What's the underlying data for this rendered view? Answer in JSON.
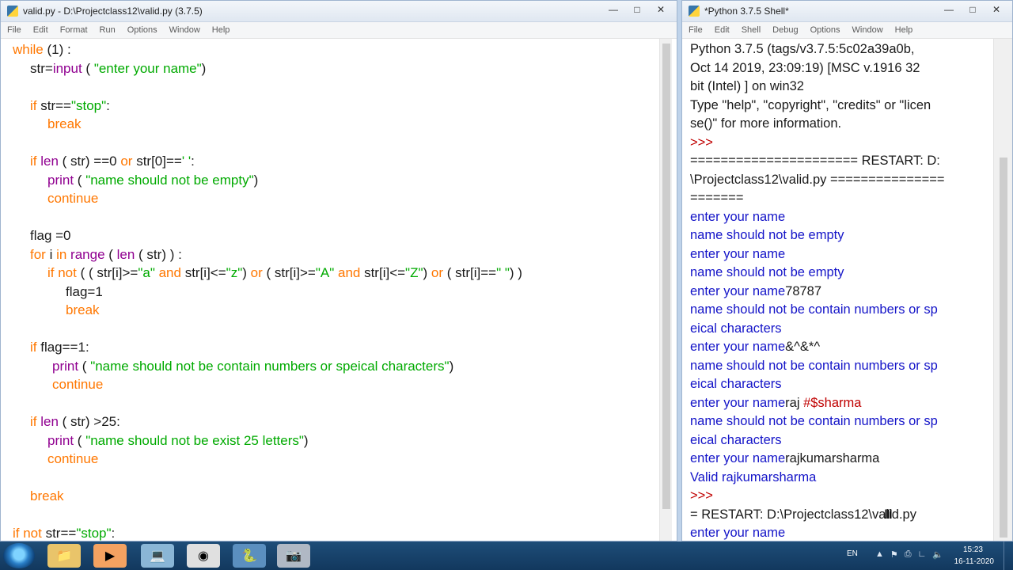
{
  "editor": {
    "title": "valid.py - D:\\Projectclass12\\valid.py (3.7.5)",
    "menu": [
      "File",
      "Edit",
      "Format",
      "Run",
      "Options",
      "Window",
      "Help"
    ],
    "lines": [
      {
        "indent": 15,
        "y": 0,
        "tokens": [
          {
            "t": "while",
            "c": "kw"
          },
          {
            "t": " (1) :",
            "c": "tx"
          }
        ]
      },
      {
        "indent": 37,
        "y": 1,
        "tokens": [
          {
            "t": "str",
            "c": "tx"
          },
          {
            "t": "=",
            "c": "tx"
          },
          {
            "t": "input",
            "c": "bi"
          },
          {
            "t": " ( ",
            "c": "tx"
          },
          {
            "t": "\"enter your name\"",
            "c": "st"
          },
          {
            "t": ")",
            "c": "tx"
          }
        ]
      },
      {
        "indent": 37,
        "y": 3,
        "tokens": [
          {
            "t": "if",
            "c": "kw"
          },
          {
            "t": " str==",
            "c": "tx"
          },
          {
            "t": "\"stop\"",
            "c": "st"
          },
          {
            "t": ":",
            "c": "tx"
          }
        ]
      },
      {
        "indent": 59,
        "y": 4,
        "tokens": [
          {
            "t": "break",
            "c": "kw"
          }
        ]
      },
      {
        "indent": 37,
        "y": 6,
        "tokens": [
          {
            "t": "if",
            "c": "kw"
          },
          {
            "t": " ",
            "c": "tx"
          },
          {
            "t": "len",
            "c": "bi"
          },
          {
            "t": " ( str) ==0 ",
            "c": "tx"
          },
          {
            "t": "or",
            "c": "kw"
          },
          {
            "t": " str[0]==",
            "c": "tx"
          },
          {
            "t": "' '",
            "c": "st"
          },
          {
            "t": ":",
            "c": "tx"
          }
        ]
      },
      {
        "indent": 59,
        "y": 7,
        "tokens": [
          {
            "t": "print",
            "c": "bi"
          },
          {
            "t": " ( ",
            "c": "tx"
          },
          {
            "t": "\"name should not be empty\"",
            "c": "st"
          },
          {
            "t": ")",
            "c": "tx"
          }
        ]
      },
      {
        "indent": 59,
        "y": 8,
        "tokens": [
          {
            "t": "continue",
            "c": "kw"
          }
        ]
      },
      {
        "indent": 37,
        "y": 10,
        "tokens": [
          {
            "t": "flag =0",
            "c": "tx"
          }
        ]
      },
      {
        "indent": 37,
        "y": 11,
        "tokens": [
          {
            "t": "for",
            "c": "kw"
          },
          {
            "t": " i ",
            "c": "tx"
          },
          {
            "t": "in",
            "c": "kw"
          },
          {
            "t": " ",
            "c": "tx"
          },
          {
            "t": "range",
            "c": "bi"
          },
          {
            "t": " ( ",
            "c": "tx"
          },
          {
            "t": "len",
            "c": "bi"
          },
          {
            "t": " ( str) ) :",
            "c": "tx"
          }
        ]
      },
      {
        "indent": 59,
        "y": 12,
        "tokens": [
          {
            "t": "if not",
            "c": "kw"
          },
          {
            "t": " ( ( str[i]>=",
            "c": "tx"
          },
          {
            "t": "\"a\"",
            "c": "st"
          },
          {
            "t": " ",
            "c": "tx"
          },
          {
            "t": "and",
            "c": "kw"
          },
          {
            "t": " str[i]<=",
            "c": "tx"
          },
          {
            "t": "\"z\"",
            "c": "st"
          },
          {
            "t": ") ",
            "c": "tx"
          },
          {
            "t": "or",
            "c": "kw"
          },
          {
            "t": " ( str[i]>=",
            "c": "tx"
          },
          {
            "t": "\"A\"",
            "c": "st"
          },
          {
            "t": " ",
            "c": "tx"
          },
          {
            "t": "and",
            "c": "kw"
          },
          {
            "t": " str[i]<=",
            "c": "tx"
          },
          {
            "t": "\"Z\"",
            "c": "st"
          },
          {
            "t": ") ",
            "c": "tx"
          },
          {
            "t": "or",
            "c": "kw"
          },
          {
            "t": " ( str[i]==",
            "c": "tx"
          },
          {
            "t": "\" \"",
            "c": "st"
          },
          {
            "t": ") )",
            "c": "tx"
          }
        ]
      },
      {
        "indent": 82,
        "y": 13,
        "tokens": [
          {
            "t": "flag=1",
            "c": "tx"
          }
        ]
      },
      {
        "indent": 82,
        "y": 14,
        "tokens": [
          {
            "t": "break",
            "c": "kw"
          }
        ]
      },
      {
        "indent": 37,
        "y": 16,
        "tokens": [
          {
            "t": "if",
            "c": "kw"
          },
          {
            "t": " flag==1:",
            "c": "tx"
          }
        ]
      },
      {
        "indent": 65,
        "y": 17,
        "tokens": [
          {
            "t": "print",
            "c": "bi"
          },
          {
            "t": " ( ",
            "c": "tx"
          },
          {
            "t": "\"name should not be contain numbers or speical characters\"",
            "c": "st"
          },
          {
            "t": ")",
            "c": "tx"
          }
        ]
      },
      {
        "indent": 65,
        "y": 18,
        "tokens": [
          {
            "t": "continue",
            "c": "kw"
          }
        ]
      },
      {
        "indent": 37,
        "y": 20,
        "tokens": [
          {
            "t": "if",
            "c": "kw"
          },
          {
            "t": " ",
            "c": "tx"
          },
          {
            "t": "len",
            "c": "bi"
          },
          {
            "t": " ( str) >25:",
            "c": "tx"
          }
        ]
      },
      {
        "indent": 59,
        "y": 21,
        "tokens": [
          {
            "t": "print",
            "c": "bi"
          },
          {
            "t": " ( ",
            "c": "tx"
          },
          {
            "t": "\"name should not be exist 25 letters\"",
            "c": "st"
          },
          {
            "t": ")",
            "c": "tx"
          }
        ]
      },
      {
        "indent": 59,
        "y": 22,
        "tokens": [
          {
            "t": "continue",
            "c": "kw"
          }
        ]
      },
      {
        "indent": 37,
        "y": 24,
        "tokens": [
          {
            "t": "break",
            "c": "kw"
          }
        ]
      },
      {
        "indent": 15,
        "y": 26,
        "tokens": [
          {
            "t": "if not",
            "c": "kw"
          },
          {
            "t": " str==",
            "c": "tx"
          },
          {
            "t": "\"stop\"",
            "c": "st"
          },
          {
            "t": ":",
            "c": "tx"
          }
        ]
      }
    ]
  },
  "shell": {
    "title": "*Python 3.7.5 Shell*",
    "menu": [
      "File",
      "Edit",
      "Shell",
      "Debug",
      "Options",
      "Window",
      "Help"
    ],
    "lines": [
      {
        "segs": [
          {
            "t": "Python 3.7.5 (tags/v3.7.5:5c02a39a0b,",
            "c": "sh-out"
          }
        ]
      },
      {
        "segs": [
          {
            "t": "Oct 14 2019, 23:09:19) [MSC v.1916 32",
            "c": "sh-out"
          }
        ]
      },
      {
        "segs": [
          {
            "t": "bit (Intel) ] on win32",
            "c": "sh-out"
          }
        ]
      },
      {
        "segs": [
          {
            "t": "Type \"help\", \"copyright\", \"credits\" or \"licen",
            "c": "sh-out"
          }
        ]
      },
      {
        "segs": [
          {
            "t": "se()\" for more information.",
            "c": "sh-out"
          }
        ]
      },
      {
        "segs": [
          {
            "t": ">>>",
            "c": "sh-prompt"
          }
        ]
      },
      {
        "segs": [
          {
            "t": "====================== RESTART: D:",
            "c": "sh-out"
          }
        ]
      },
      {
        "segs": [
          {
            "t": "\\Projectclass12\\valid.py ===============",
            "c": "sh-out"
          }
        ]
      },
      {
        "segs": [
          {
            "t": "=======",
            "c": "sh-out"
          }
        ]
      },
      {
        "segs": [
          {
            "t": "enter your name",
            "c": "sh-blue"
          }
        ]
      },
      {
        "segs": [
          {
            "t": "name should not be empty",
            "c": "sh-blue"
          }
        ]
      },
      {
        "segs": [
          {
            "t": "enter your name",
            "c": "sh-blue"
          }
        ]
      },
      {
        "segs": [
          {
            "t": "name should not be empty",
            "c": "sh-blue"
          }
        ]
      },
      {
        "segs": [
          {
            "t": "enter your name",
            "c": "sh-blue"
          },
          {
            "t": "78787",
            "c": "sh-out"
          }
        ]
      },
      {
        "segs": [
          {
            "t": "name should not be contain numbers or sp",
            "c": "sh-blue"
          }
        ]
      },
      {
        "segs": [
          {
            "t": "eical characters",
            "c": "sh-blue"
          }
        ]
      },
      {
        "segs": [
          {
            "t": "enter your name",
            "c": "sh-blue"
          },
          {
            "t": "&^&*^",
            "c": "sh-out"
          }
        ]
      },
      {
        "segs": [
          {
            "t": "name should not be contain numbers or sp",
            "c": "sh-blue"
          }
        ]
      },
      {
        "segs": [
          {
            "t": "eical characters",
            "c": "sh-blue"
          }
        ]
      },
      {
        "segs": [
          {
            "t": "enter your name",
            "c": "sh-blue"
          },
          {
            "t": "raj ",
            "c": "sh-out"
          },
          {
            "t": "#$sharma",
            "c": "sh-err"
          }
        ]
      },
      {
        "segs": [
          {
            "t": "name should not be contain numbers or sp",
            "c": "sh-blue"
          }
        ]
      },
      {
        "segs": [
          {
            "t": "eical characters",
            "c": "sh-blue"
          }
        ]
      },
      {
        "segs": [
          {
            "t": "enter your name",
            "c": "sh-blue"
          },
          {
            "t": "rajkumarsharma",
            "c": "sh-out"
          }
        ]
      },
      {
        "segs": [
          {
            "t": "Valid rajkumarsharma",
            "c": "sh-blue"
          }
        ]
      },
      {
        "segs": [
          {
            "t": ">>>",
            "c": "sh-prompt"
          }
        ]
      },
      {
        "segs": [
          {
            "t": "= RESTART: D:\\Projectclass12\\valid.py",
            "c": "sh-out"
          }
        ]
      },
      {
        "segs": [
          {
            "t": "enter your name",
            "c": "sh-blue"
          }
        ]
      }
    ]
  },
  "taskbar": {
    "language": "EN",
    "time": "15:23",
    "date": "16-11-2020"
  },
  "colors": {
    "keyword": "#ff7700",
    "builtin": "#900090",
    "string": "#00aa00",
    "shell_output": "#1414c8",
    "prompt": "#c00000"
  }
}
